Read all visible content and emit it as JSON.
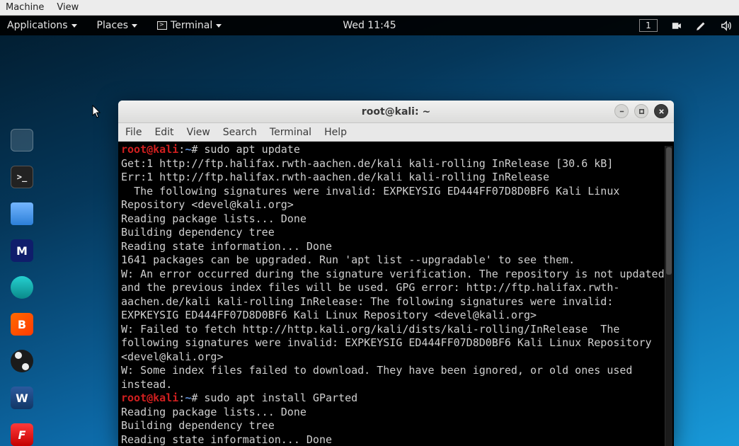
{
  "vm_menu": {
    "machine": "Machine",
    "view": "View"
  },
  "panel": {
    "applications": "Applications",
    "places": "Places",
    "terminal": "Terminal",
    "clock": "Wed 11:45",
    "workspace": "1"
  },
  "dock": [
    {
      "name": "firefox",
      "letter": ""
    },
    {
      "name": "terminal",
      "letter": ""
    },
    {
      "name": "files",
      "letter": ""
    },
    {
      "name": "metasploit",
      "letter": "M"
    },
    {
      "name": "armitage",
      "letter": ""
    },
    {
      "name": "burpsuite",
      "letter": "B"
    },
    {
      "name": "obs",
      "letter": ""
    },
    {
      "name": "wireshark",
      "letter": "W"
    },
    {
      "name": "faraday",
      "letter": "F"
    }
  ],
  "window": {
    "title": "root@kali: ~",
    "menu": {
      "file": "File",
      "edit": "Edit",
      "view": "View",
      "search": "Search",
      "terminal": "Terminal",
      "help": "Help"
    }
  },
  "prompt": {
    "user": "root",
    "host": "kali",
    "path": "~",
    "symbol": "#"
  },
  "commands": {
    "c1": "sudo apt update",
    "c2": "sudo apt install GParted"
  },
  "output": {
    "l01": "Get:1 http://ftp.halifax.rwth-aachen.de/kali kali-rolling InRelease [30.6 kB]",
    "l02": "Err:1 http://ftp.halifax.rwth-aachen.de/kali kali-rolling InRelease",
    "l03": "  The following signatures were invalid: EXPKEYSIG ED444FF07D8D0BF6 Kali Linux Repository <devel@kali.org>",
    "l04": "Reading package lists... Done",
    "l05": "Building dependency tree",
    "l06": "Reading state information... Done",
    "l07": "1641 packages can be upgraded. Run 'apt list --upgradable' to see them.",
    "l08": "W: An error occurred during the signature verification. The repository is not updated and the previous index files will be used. GPG error: http://ftp.halifax.rwth-aachen.de/kali kali-rolling InRelease: The following signatures were invalid: EXPKEYSIG ED444FF07D8D0BF6 Kali Linux Repository <devel@kali.org>",
    "l09": "W: Failed to fetch http://http.kali.org/kali/dists/kali-rolling/InRelease  The following signatures were invalid: EXPKEYSIG ED444FF07D8D0BF6 Kali Linux Repository <devel@kali.org>",
    "l10": "W: Some index files failed to download. They have been ignored, or old ones used instead.",
    "l11": "Reading package lists... Done",
    "l12": "Building dependency tree",
    "l13": "Reading state information... Done"
  }
}
